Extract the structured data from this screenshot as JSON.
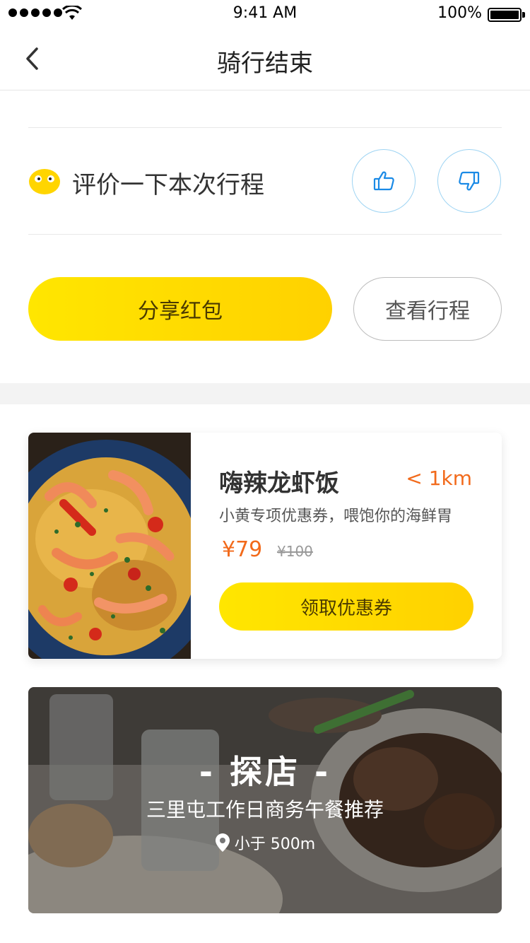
{
  "status_bar": {
    "time": "9:41 AM",
    "battery": "100%"
  },
  "nav": {
    "title": "骑行结束"
  },
  "rating": {
    "prompt": "评价一下本次行程"
  },
  "actions": {
    "share_label": "分享红包",
    "view_trip_label": "查看行程"
  },
  "coupon_card": {
    "title": "嗨辣龙虾饭",
    "distance": "< 1km",
    "description": "小黄专项优惠券，喂饱你的海鲜胃",
    "price": "¥79",
    "original_price": "¥100",
    "button_label": "领取优惠券"
  },
  "explore_banner": {
    "title": "- 探店 -",
    "subtitle": "三里屯工作日商务午餐推荐",
    "location": "小于 500m"
  },
  "colors": {
    "accent_yellow": "#ffdd00",
    "price_orange": "#f26a1b",
    "icon_blue": "#1a8ae6"
  }
}
